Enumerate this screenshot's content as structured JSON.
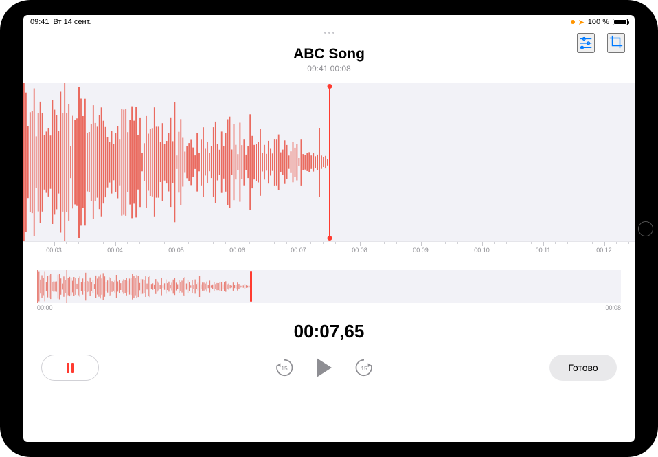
{
  "status": {
    "time": "09:41",
    "date": "Вт 14 сент.",
    "battery_pct": "100 %"
  },
  "toolbar": {
    "options_icon": "options",
    "trim_icon": "trim"
  },
  "recording": {
    "title": "ABC Song",
    "subtitle": "09:41  00:08"
  },
  "ruler": {
    "ticks": [
      "00:03",
      "00:04",
      "00:05",
      "00:06",
      "00:07",
      "00:08",
      "00:09",
      "00:10",
      "00:11",
      "00:12"
    ]
  },
  "overview": {
    "start": "00:00",
    "end": "00:08",
    "playhead_fraction": 0.365
  },
  "playback": {
    "playhead_fraction": 0.5,
    "current_time": "00:07,65",
    "skip_amount": "15"
  },
  "controls": {
    "done_label": "Готово"
  },
  "colors": {
    "accent_red": "#ff3b30",
    "system_blue": "#007aff",
    "bg_gray": "#f2f2f7"
  }
}
